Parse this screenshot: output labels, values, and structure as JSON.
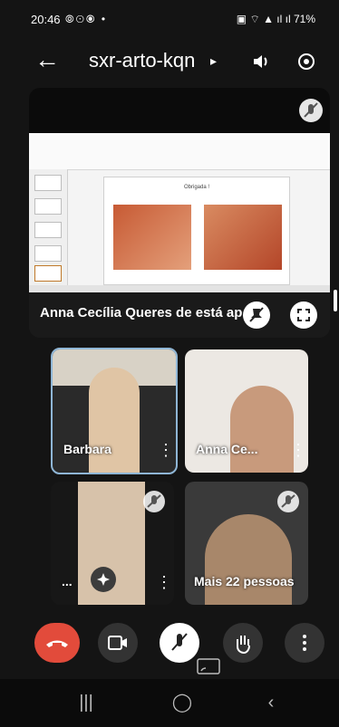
{
  "status_bar": {
    "time": "20:46",
    "battery": "71%"
  },
  "header": {
    "meeting_code": "sxr-arto-kqn"
  },
  "presentation": {
    "slide_title": "Obrigada !",
    "presenter_label": "Anna Cecília Queres de está ap..."
  },
  "tiles": [
    {
      "name": "Barbara"
    },
    {
      "name": "Anna Ce..."
    },
    {
      "name": "..."
    },
    {
      "name": "Mais 22 pessoas"
    }
  ],
  "icons": {
    "end_call_color": "#e24b3b"
  }
}
